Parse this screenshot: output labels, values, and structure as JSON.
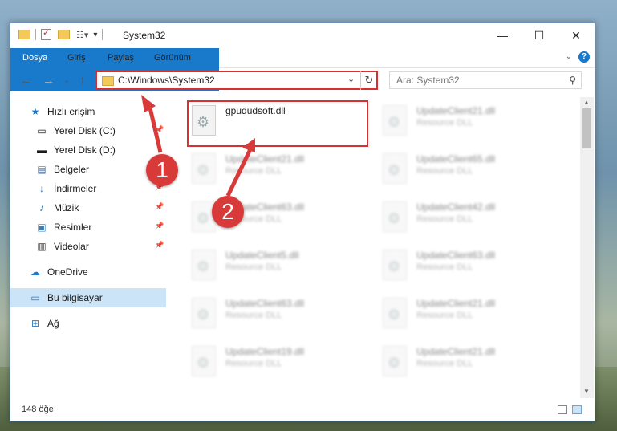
{
  "window": {
    "title": "System32"
  },
  "ribbon": {
    "tabs": [
      "Dosya",
      "Giriş",
      "Paylaş",
      "Görünüm"
    ]
  },
  "navigation": {
    "address": "C:\\Windows\\System32",
    "search_placeholder": "Ara: System32"
  },
  "sidebar": {
    "items": [
      {
        "label": "Hızlı erişim",
        "icon": "star-icon",
        "pinned": false,
        "selected": false
      },
      {
        "label": "Yerel Disk (C:)",
        "icon": "drive-icon",
        "pinned": true,
        "selected": false
      },
      {
        "label": "Yerel Disk (D:)",
        "icon": "drive-icon",
        "pinned": false,
        "selected": false
      },
      {
        "label": "Belgeler",
        "icon": "document-icon",
        "pinned": true,
        "selected": false
      },
      {
        "label": "İndirmeler",
        "icon": "download-icon",
        "pinned": true,
        "selected": false
      },
      {
        "label": "Müzik",
        "icon": "music-icon",
        "pinned": true,
        "selected": false
      },
      {
        "label": "Resimler",
        "icon": "pictures-icon",
        "pinned": true,
        "selected": false
      },
      {
        "label": "Videolar",
        "icon": "video-icon",
        "pinned": true,
        "selected": false
      },
      {
        "label": "OneDrive",
        "icon": "cloud-icon",
        "pinned": false,
        "selected": false
      },
      {
        "label": "Bu bilgisayar",
        "icon": "computer-icon",
        "pinned": false,
        "selected": true
      },
      {
        "label": "Ağ",
        "icon": "network-icon",
        "pinned": false,
        "selected": false
      }
    ]
  },
  "files": [
    {
      "name": "gpududsoft.dll",
      "type": "",
      "highlighted": true
    },
    {
      "name": "UpdateClient21.dll",
      "type": "Resource DLL"
    },
    {
      "name": "UpdateClient21.dll",
      "type": "Resource DLL"
    },
    {
      "name": "UpdateClient65.dll",
      "type": "Resource DLL"
    },
    {
      "name": "UpdateClient63.dll",
      "type": "Resource DLL"
    },
    {
      "name": "UpdateClient42.dll",
      "type": "Resource DLL"
    },
    {
      "name": "UpdateClient5.dll",
      "type": "Resource DLL"
    },
    {
      "name": "UpdateClient63.dll",
      "type": "Resource DLL"
    },
    {
      "name": "UpdateClient63.dll",
      "type": "Resource DLL"
    },
    {
      "name": "UpdateClient21.dll",
      "type": "Resource DLL"
    },
    {
      "name": "UpdateClient19.dll",
      "type": "Resource DLL"
    },
    {
      "name": "UpdateClient21.dll",
      "type": "Resource DLL"
    }
  ],
  "status": {
    "item_count": "148 öğe"
  },
  "annotations": {
    "step1": "1",
    "step2": "2"
  },
  "colors": {
    "accent": "#1979ca",
    "highlight": "#d83030",
    "selected": "#cce4f7"
  }
}
